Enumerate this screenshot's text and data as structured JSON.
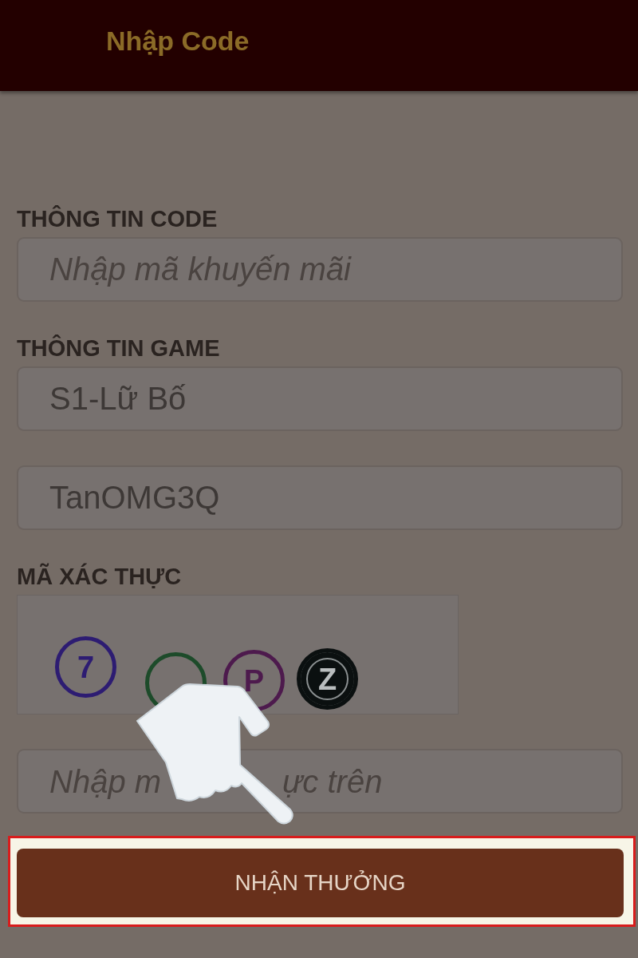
{
  "header": {
    "title": "Nhập Code"
  },
  "sections": [
    {
      "label": "THÔNG TIN CODE",
      "fields": [
        {
          "kind": "input",
          "placeholder": "Nhập mã khuyến mãi"
        }
      ]
    },
    {
      "label": "THÔNG TIN GAME",
      "fields": [
        {
          "kind": "input",
          "value": "S1-Lữ Bố"
        },
        {
          "kind": "input",
          "value": "TanOMG3Q"
        }
      ]
    },
    {
      "label": "MÃ XÁC THỰC",
      "fields": [
        {
          "kind": "captcha",
          "characters": [
            {
              "kind": "ring",
              "char": "7",
              "color": "#2d1c72"
            },
            {
              "kind": "ring",
              "color": "#1d4b2a"
            },
            {
              "kind": "ring",
              "char": "P",
              "color": "#4d1a4d"
            },
            {
              "kind": "disc",
              "char": "Z",
              "color": "#0b1010"
            }
          ]
        },
        {
          "kind": "input",
          "placeholder_parts": [
            "Nhập m",
            "ực trên"
          ]
        }
      ]
    }
  ],
  "submit_button": {
    "label": "NHẬN THƯỞNG",
    "highlighted": true
  }
}
